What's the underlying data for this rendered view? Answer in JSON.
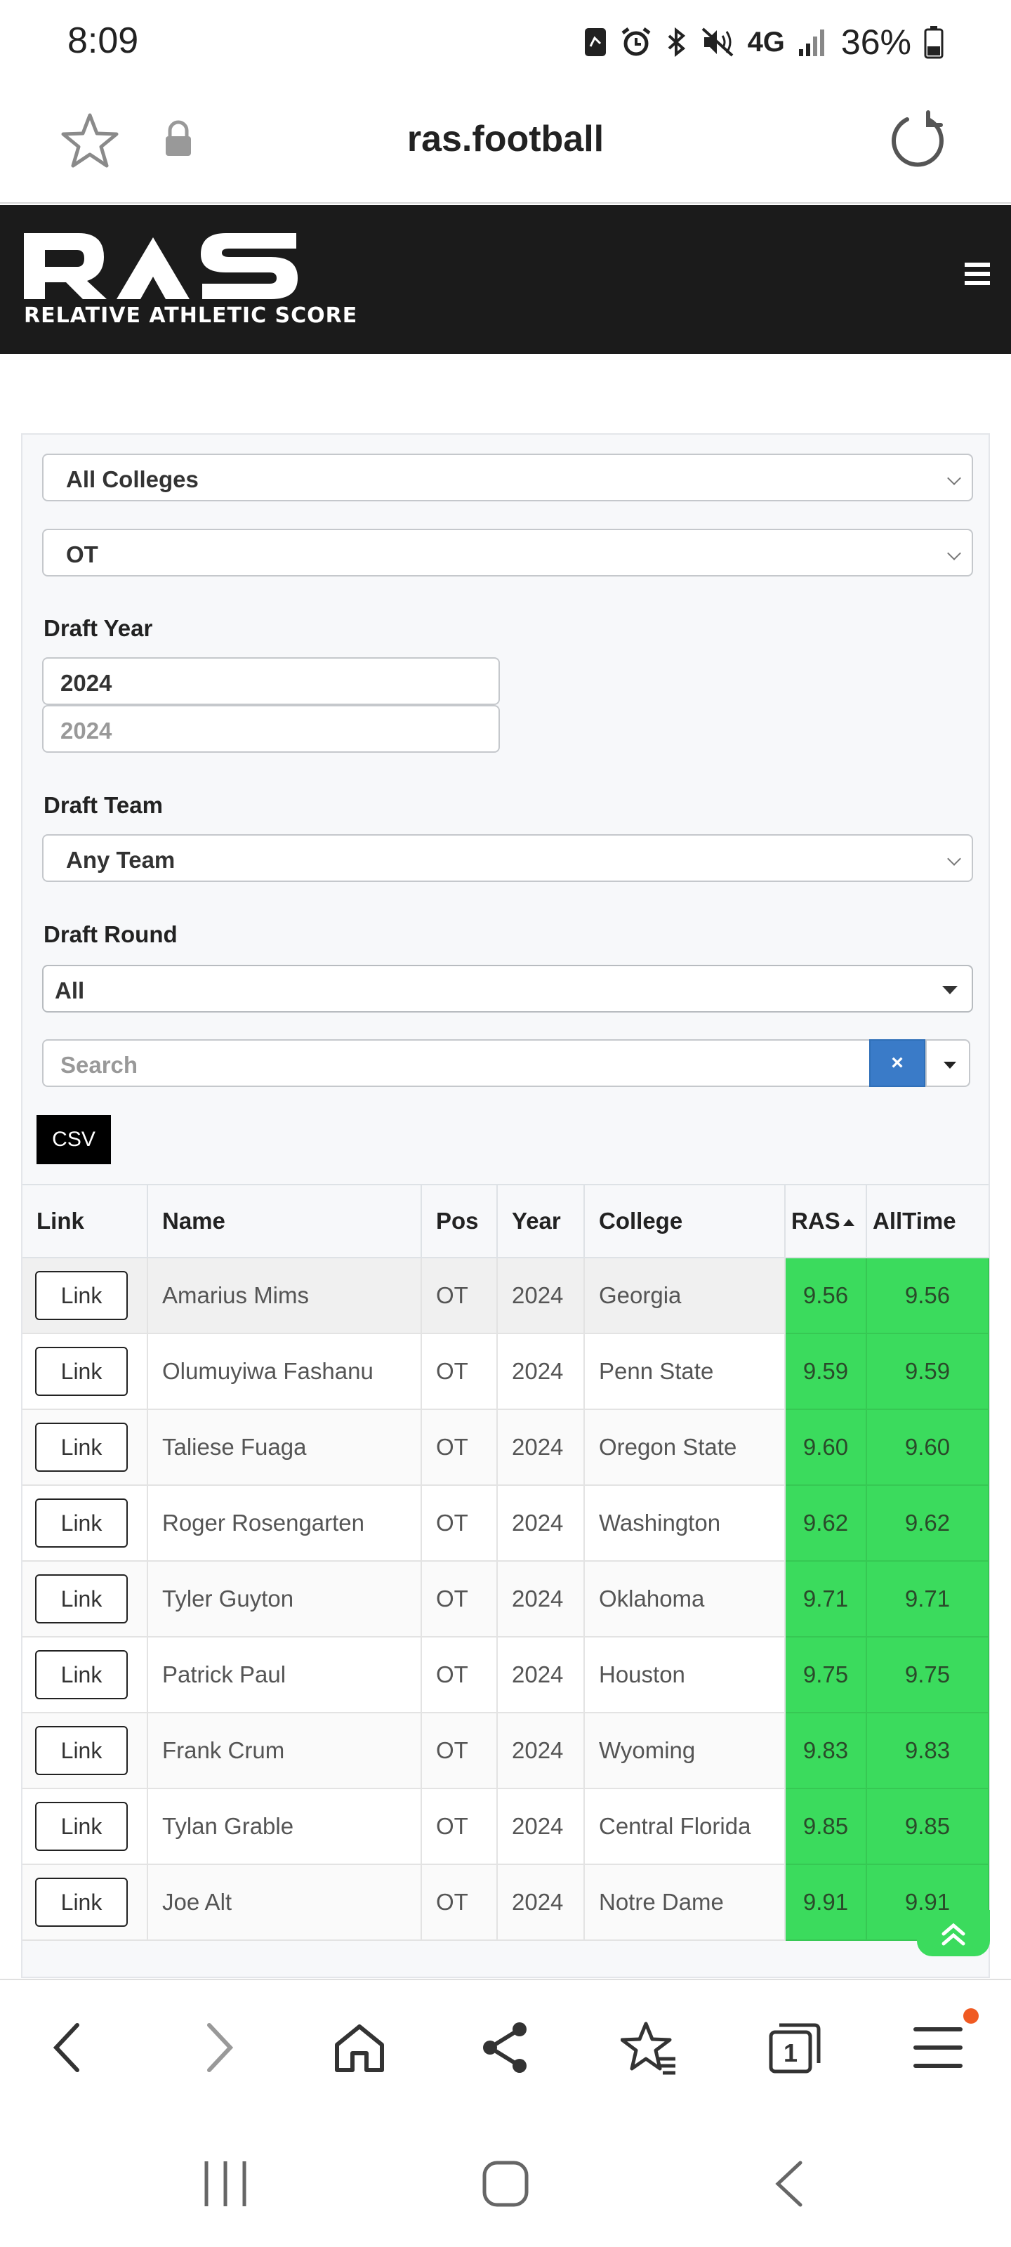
{
  "status_bar": {
    "time": "8:09",
    "network": "4G",
    "battery": "36%",
    "icons": [
      "sim-icon",
      "alarm-icon",
      "bluetooth-icon",
      "mute-icon",
      "signal-icon",
      "battery-icon"
    ]
  },
  "browser": {
    "url": "ras.football",
    "icons": [
      "star-icon",
      "lock-icon",
      "reload-icon"
    ]
  },
  "site": {
    "logo_text": "RAS",
    "logo_subtitle": "RELATIVE ATHLETIC SCORE",
    "menu_icon": "hamburger-icon"
  },
  "filters": {
    "college": "All Colleges",
    "position": "OT",
    "draft_year_label": "Draft Year",
    "draft_year_from": "2024",
    "draft_year_to": "2024",
    "draft_team_label": "Draft Team",
    "draft_team": "Any Team",
    "draft_round_label": "Draft Round",
    "draft_round": "All",
    "search_placeholder": "Search",
    "clear_label": "×",
    "csv_label": "CSV"
  },
  "table": {
    "headers": [
      "Link",
      "Name",
      "Pos",
      "Year",
      "College",
      "RAS",
      "AllTime"
    ],
    "link_label": "Link",
    "rows": [
      {
        "name": "Amarius Mims",
        "pos": "OT",
        "year": "2024",
        "college": "Georgia",
        "ras": "9.56",
        "alltime": "9.56"
      },
      {
        "name": "Olumuyiwa Fashanu",
        "pos": "OT",
        "year": "2024",
        "college": "Penn State",
        "ras": "9.59",
        "alltime": "9.59"
      },
      {
        "name": "Taliese Fuaga",
        "pos": "OT",
        "year": "2024",
        "college": "Oregon State",
        "ras": "9.60",
        "alltime": "9.60"
      },
      {
        "name": "Roger Rosengarten",
        "pos": "OT",
        "year": "2024",
        "college": "Washington",
        "ras": "9.62",
        "alltime": "9.62"
      },
      {
        "name": "Tyler Guyton",
        "pos": "OT",
        "year": "2024",
        "college": "Oklahoma",
        "ras": "9.71",
        "alltime": "9.71"
      },
      {
        "name": "Patrick Paul",
        "pos": "OT",
        "year": "2024",
        "college": "Houston",
        "ras": "9.75",
        "alltime": "9.75"
      },
      {
        "name": "Frank Crum",
        "pos": "OT",
        "year": "2024",
        "college": "Wyoming",
        "ras": "9.83",
        "alltime": "9.83"
      },
      {
        "name": "Tylan Grable",
        "pos": "OT",
        "year": "2024",
        "college": "Central Florida",
        "ras": "9.85",
        "alltime": "9.85"
      },
      {
        "name": "Joe Alt",
        "pos": "OT",
        "year": "2024",
        "college": "Notre Dame",
        "ras": "9.91",
        "alltime": "9.91"
      }
    ]
  },
  "bottom_toolbar": {
    "icons": [
      "back-icon",
      "forward-icon",
      "home-icon",
      "share-icon",
      "bookmarks-icon",
      "tabs-icon",
      "menu-icon"
    ],
    "tab_count": "1"
  },
  "nav_bar": {
    "icons": [
      "recents-icon",
      "home-circle-icon",
      "back-chevron-icon"
    ]
  },
  "colors": {
    "header_bg": "#1b1b1b",
    "ras_green": "#3bdb5d",
    "clear_button": "#3a7bc8",
    "notification": "#f05a22"
  }
}
